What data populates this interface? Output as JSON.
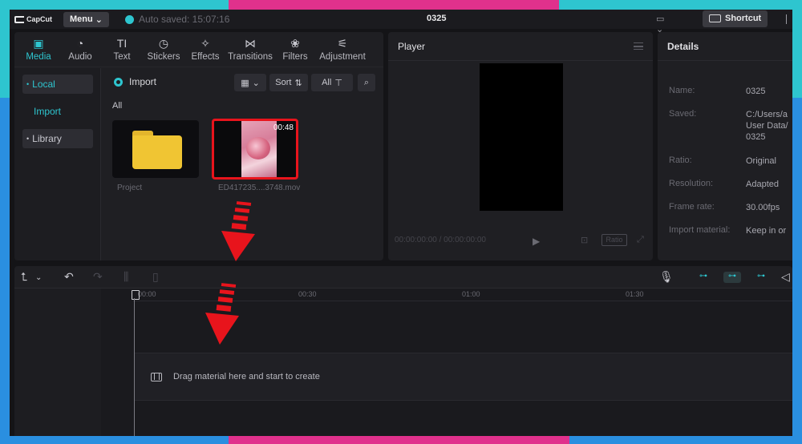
{
  "titlebar": {
    "logo_text": "CapCut",
    "menu_label": "Menu",
    "autosave_text": "Auto saved: 15:07:16",
    "project_title": "0325",
    "shortcut_label": "Shortcut"
  },
  "media_tabs": [
    {
      "label": "Media",
      "icon": "media-icon",
      "active": true
    },
    {
      "label": "Audio",
      "icon": "audio-icon"
    },
    {
      "label": "Text",
      "icon": "text-icon"
    },
    {
      "label": "Stickers",
      "icon": "stickers-icon"
    },
    {
      "label": "Effects",
      "icon": "effects-icon"
    },
    {
      "label": "Transitions",
      "icon": "transitions-icon"
    },
    {
      "label": "Filters",
      "icon": "filters-icon"
    },
    {
      "label": "Adjustment",
      "icon": "adjustment-icon"
    }
  ],
  "sidebar": {
    "local": "Local",
    "import": "Import",
    "library": "Library"
  },
  "media_toolbar": {
    "import_label": "Import",
    "sort_label": "Sort",
    "all_label": "All",
    "section_label": "All"
  },
  "media_items": {
    "folder_caption": "Project",
    "video_caption": "ED417235....3748.mov",
    "video_duration": "00:48"
  },
  "player": {
    "title": "Player",
    "timecode": "00:00:00:00 / 00:00:00:00",
    "ratio_label": "Ratio"
  },
  "details": {
    "title": "Details",
    "rows": [
      {
        "label": "Name:",
        "value": "0325"
      },
      {
        "label": "Saved:",
        "value": "C:/Users/a\nUser Data/\n0325"
      },
      {
        "label": "Ratio:",
        "value": "Original"
      },
      {
        "label": "Resolution:",
        "value": "Adapted"
      },
      {
        "label": "Frame rate:",
        "value": "30.00fps"
      },
      {
        "label": "Import material:",
        "value": "Keep in or"
      }
    ]
  },
  "timeline": {
    "ticks": [
      "00:00",
      "00:30",
      "01:00",
      "01:30"
    ],
    "drop_hint": "Drag material here and start to create"
  },
  "colors": {
    "accent": "#2ec5cf",
    "highlight_border": "#e8141c",
    "folder": "#f0c533"
  }
}
